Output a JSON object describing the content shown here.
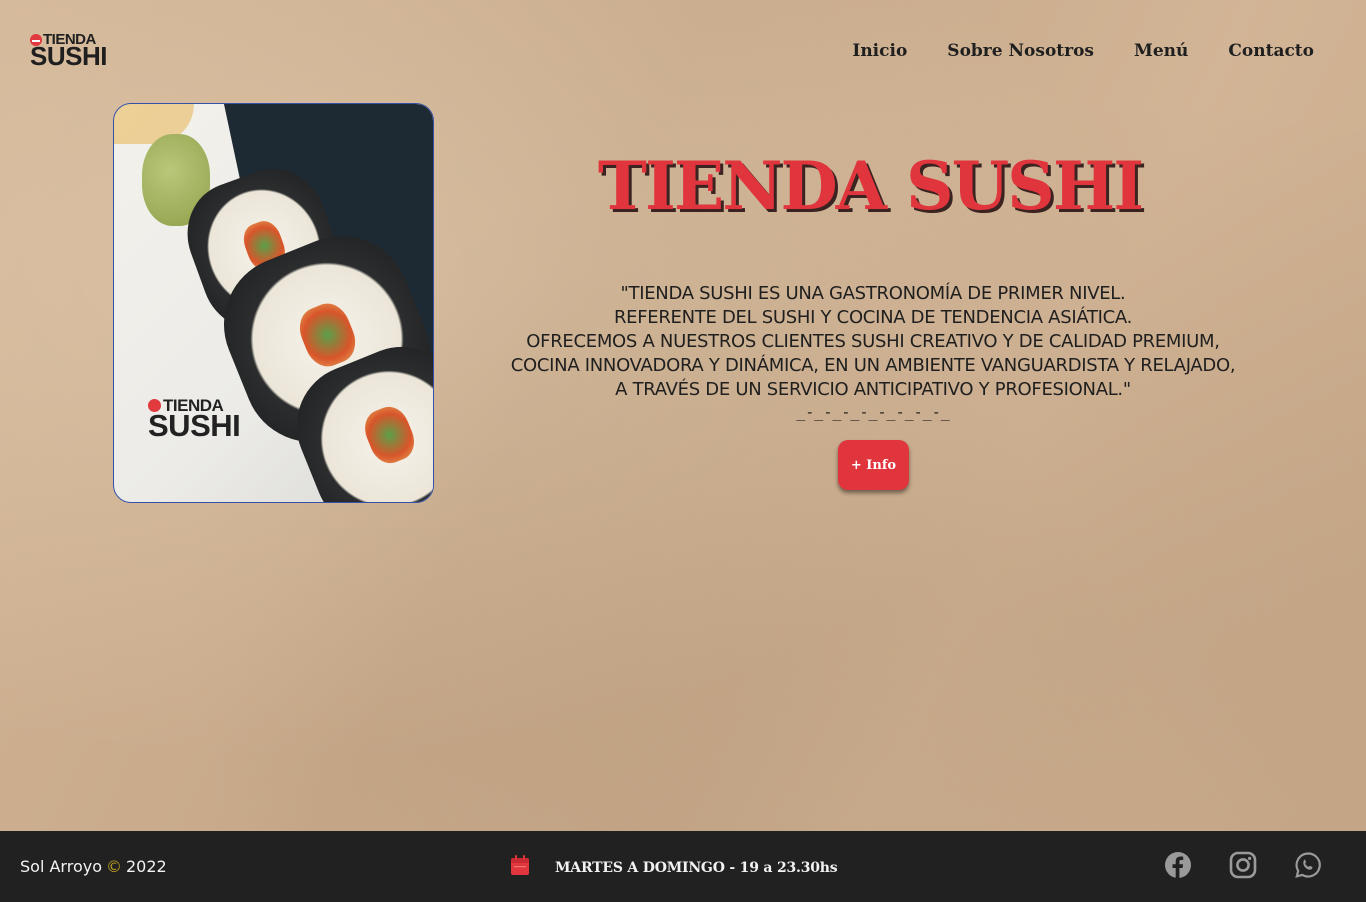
{
  "header": {
    "logo": {
      "line1": "TIENDA",
      "line2": "SUSHI"
    },
    "nav": [
      {
        "label": "Inicio"
      },
      {
        "label": "Sobre Nosotros"
      },
      {
        "label": "Menú"
      },
      {
        "label": "Contacto"
      }
    ]
  },
  "hero": {
    "image_brand": {
      "line1": "TIENDA",
      "line2": "SUSHI"
    },
    "title": "TIENDA SUSHI",
    "quote_lines": [
      "\"TIENDA SUSHI ES UNA GASTRONOMÍA DE PRIMER NIVEL.",
      "REFERENTE DEL SUSHI Y COCINA DE TENDENCIA ASIÁTICA.",
      "OFRECEMOS A NUESTROS CLIENTES SUSHI CREATIVO Y DE CALIDAD PREMIUM,",
      "COCINA INNOVADORA Y DINÁMICA, EN UN AMBIENTE VANGUARDISTA Y RELAJADO,",
      "A TRAVÉS DE UN SERVICIO ANTICIPATIVO Y PROFESIONAL.\""
    ],
    "decoration": "_-_-_-_-_-_-_-_-_",
    "info_button": "+ Info"
  },
  "footer": {
    "author": "Sol Arroyo",
    "copyright_symbol": "©",
    "year": "2022",
    "hours": "MARTES A DOMINGO - 19 a 23.30hs",
    "social": [
      "facebook-icon",
      "instagram-icon",
      "whatsapp-icon"
    ]
  },
  "colors": {
    "accent": "#e0353d",
    "footer_bg": "#212121",
    "paper": "#cfb08f",
    "text": "#1f1f1f"
  }
}
